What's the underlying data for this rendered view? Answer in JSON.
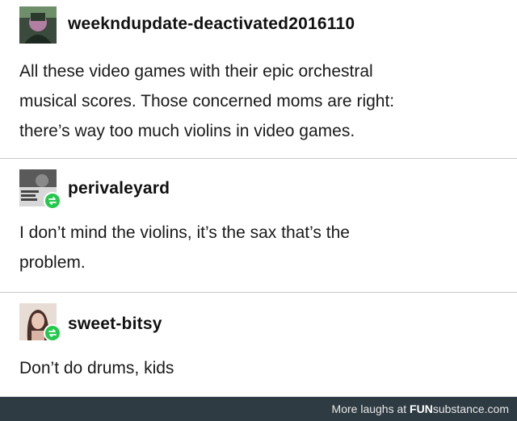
{
  "posts": [
    {
      "username": "weekndupdate-deactivated2016110",
      "lines": [
        "All these video games with their epic orchestral",
        "musical scores. Those concerned moms are right:",
        "there’s way too much violins in video games."
      ]
    },
    {
      "username": "perivaleyard",
      "lines": [
        "I don’t mind the violins, it’s the sax that’s the",
        "problem."
      ]
    },
    {
      "username": "sweet-bitsy",
      "lines": [
        "Don’t do drums, kids"
      ]
    }
  ],
  "footer": {
    "prefix": "More laughs at ",
    "brand_bold": "FUN",
    "brand_rest": "substance.com"
  },
  "colors": {
    "reblog_badge": "#23c94c",
    "footer_bg": "#2e3b42",
    "divider": "#c9c9c9"
  }
}
